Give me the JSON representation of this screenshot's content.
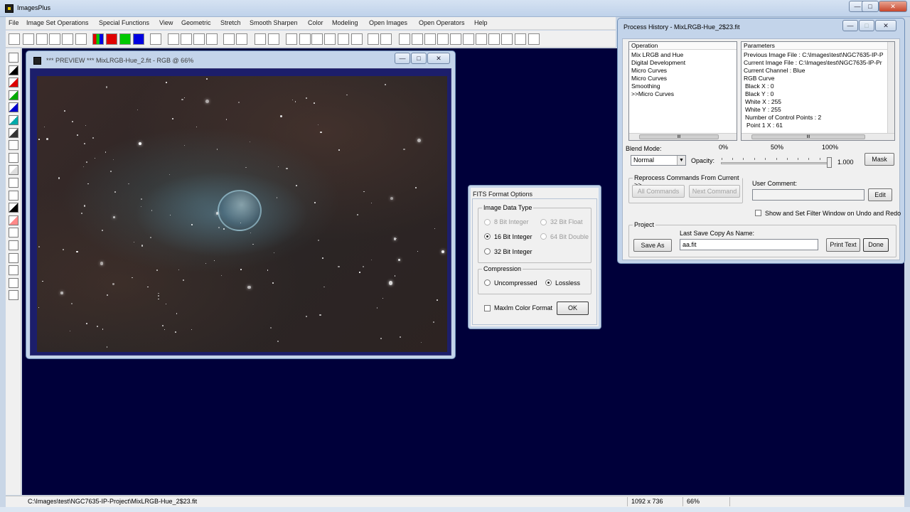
{
  "app": {
    "title": "ImagesPlus",
    "window_buttons": [
      "—",
      "□",
      "✕"
    ]
  },
  "menu": [
    "File",
    "Image Set Operations",
    "Special Functions",
    "View",
    "Geometric",
    "Stretch",
    "Smooth Sharpen",
    "Color",
    "Modeling",
    "Open Images",
    "Open Operators",
    "Help"
  ],
  "toolbar": {
    "icons": [
      "new-file-icon",
      "open-folder-icon",
      "save-icon",
      "close-x-icon",
      "close-all-icon",
      "print-icon",
      "rgb-split-icon",
      "red-channel-icon",
      "green-channel-icon",
      "blue-channel-icon",
      "grid-icon",
      "undo-icon",
      "redo-icon",
      "undo-all-icon",
      "redo-all-icon",
      "star-dot-icon",
      "stop-icon",
      "dots-icon",
      "tree-icon",
      "histogram-icon",
      "curve-icon",
      "crosshair-icon",
      "cross-icon",
      "table-icon",
      "chart-icon",
      "pencil-icon",
      "mosaic-icon",
      "zoom-in-icon",
      "zoom-out-icon",
      "zoom-fit-icon",
      "zoom-actual-icon",
      "add-icon",
      "subtract-icon",
      "square-icon",
      "square-icon",
      "square-icon",
      "square-icon",
      "square-icon"
    ],
    "colors": {
      "red": "#e00000",
      "green": "#00c800",
      "blue": "#0000e0"
    }
  },
  "left_tools": [
    "save-icon",
    "channel-black-icon",
    "channel-red-icon",
    "channel-green-icon",
    "channel-blue-icon",
    "channel-cyan-icon",
    "channel-dark-icon",
    "channel-white-icon",
    "pin-icon",
    "gradient-icon",
    "select-icon",
    "levels-icon",
    "bar-icon",
    "crop-icon",
    "move-icon",
    "up-arrow-icon",
    "right-arrow-icon",
    "rotate-icon",
    "flip-icon",
    "copy-icon"
  ],
  "preview": {
    "title": "*** PREVIEW *** MixLRGB-Hue_2.fit - RGB @ 66%",
    "buttons": [
      "—",
      "□",
      "✕"
    ]
  },
  "fits_dialog": {
    "title": "FITS Format Options",
    "data_type_label": "Image Data Type",
    "options": [
      {
        "label": "8 Bit Integer",
        "selected": false,
        "enabled": false
      },
      {
        "label": "32 Bit Float",
        "selected": false,
        "enabled": false
      },
      {
        "label": "16 Bit Integer",
        "selected": true,
        "enabled": true
      },
      {
        "label": "64 Bit Double",
        "selected": false,
        "enabled": false
      },
      {
        "label": "32 Bit Integer",
        "selected": false,
        "enabled": true
      }
    ],
    "compression_label": "Compression",
    "compression": [
      {
        "label": "Uncompressed",
        "selected": false
      },
      {
        "label": "Lossless",
        "selected": true
      }
    ],
    "maxim_label": "MaxIm Color Format",
    "maxim_checked": false,
    "ok_label": "OK"
  },
  "history": {
    "title": "Process History - MixLRGB-Hue_2$23.fit",
    "buttons": [
      "—",
      "□",
      "✕"
    ],
    "operation_header": "Operation",
    "operations": [
      "Mix LRGB and Hue",
      "Digital Development",
      "Micro Curves",
      "Micro Curves",
      "Smoothing",
      ">>Micro Curves"
    ],
    "parameters_header": "Parameters",
    "parameters": [
      "Previous Image File : C:\\Images\\test\\NGC7635-IP-P",
      "Current Image File : C:\\Images\\test\\NGC7635-IP-Pr",
      "Current Channel : Blue",
      "RGB Curve",
      "Black X : 0",
      "Black Y : 0",
      "White X : 255",
      "White Y : 255",
      "Number of Control Points : 2",
      "Point 1 X : 61"
    ],
    "scroll_grip": "III",
    "blend_mode_label": "Blend Mode:",
    "blend_mode_value": "Normal",
    "opacity_label": "Opacity:",
    "opacity_ticks": [
      "0%",
      "50%",
      "100%"
    ],
    "opacity_value": "1.000",
    "opacity_fraction": 1.0,
    "mask_label": "Mask",
    "reprocess_label": "Reprocess Commands From Current >>",
    "all_commands_label": "All Commands",
    "next_command_label": "Next Command",
    "user_comment_label": "User Comment:",
    "user_comment_value": "",
    "edit_label": "Edit",
    "show_filter_label": "Show and Set Filter Window on Undo and Redo",
    "show_filter_checked": false,
    "project_label": "Project",
    "last_save_label": "Last Save Copy As Name:",
    "save_as_label": "Save As",
    "save_name_value": "aa.fit",
    "print_text_label": "Print Text",
    "done_label": "Done"
  },
  "status": {
    "path": "C:\\Images\\test\\NGC7635-IP-Project\\MixLRGB-Hue_2$23.fit",
    "dimensions": "1092 x 736",
    "zoom": "66%"
  }
}
